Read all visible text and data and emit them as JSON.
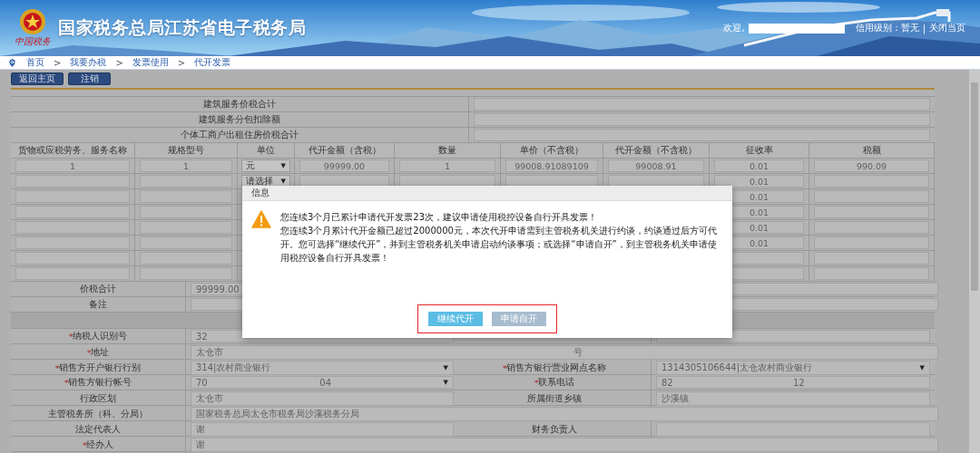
{
  "header": {
    "title": "国家税务总局江苏省电子税务局",
    "logo_caption": "中国税务",
    "welcome": "欢迎,",
    "credit": "信用级别：暂无",
    "separator": "|",
    "close": "关闭当页"
  },
  "breadcrumb": {
    "separator": ">",
    "items": [
      "首页",
      "我要办税",
      "发票使用",
      "代开发票"
    ]
  },
  "toolbar": [
    "返回主页",
    "注销"
  ],
  "summary_rows": [
    {
      "label": "建筑服务价税合计"
    },
    {
      "label": "建筑服务分包扣除额"
    },
    {
      "label": "个体工商户出租住房价税合计"
    }
  ],
  "goods_table": {
    "columns": [
      {
        "label": "货物或应税劳务、服务名称",
        "kind": "text"
      },
      {
        "label": "规格型号",
        "kind": "text"
      },
      {
        "label": "单位",
        "kind": "select"
      },
      {
        "label": "代开金额（含税）",
        "kind": "text"
      },
      {
        "label": "数量",
        "kind": "text"
      },
      {
        "label": "单价（不含税）",
        "kind": "text"
      },
      {
        "label": "代开金额（不含税）",
        "kind": "text"
      },
      {
        "label": "征收率",
        "kind": "text"
      },
      {
        "label": "税额",
        "kind": "text"
      }
    ],
    "rows": [
      [
        "1",
        "1",
        "元",
        "99999.00",
        "1",
        "99008.91089109",
        "99008.91",
        "0.01",
        "990.09"
      ],
      [
        null,
        null,
        "请选择",
        null,
        null,
        null,
        null,
        "0.01",
        null
      ],
      [
        null,
        null,
        null,
        null,
        null,
        null,
        null,
        "0.01",
        null
      ],
      [
        null,
        null,
        null,
        null,
        null,
        null,
        null,
        "0.01",
        null
      ],
      [
        null,
        null,
        null,
        null,
        null,
        null,
        null,
        "0.01",
        null
      ],
      [
        null,
        null,
        null,
        null,
        null,
        null,
        null,
        "0.01",
        null
      ],
      [
        null,
        null,
        null,
        null,
        null,
        null,
        null,
        null,
        null
      ],
      [
        null,
        null,
        null,
        null,
        null,
        null,
        null,
        null,
        null
      ]
    ]
  },
  "caret": "▼",
  "total": {
    "label": "价税合计",
    "value": "99999.00"
  },
  "remark": {
    "label": "备注"
  },
  "required_mark": "*",
  "seller_rows": [
    {
      "fields": [
        {
          "label": "纳税人识别号",
          "required": true,
          "kind": "text",
          "value": "32"
        },
        {
          "kind": "text"
        }
      ]
    },
    {
      "fields": [
        {
          "label": "地址",
          "required": true,
          "kind": "text",
          "value": "太仓市",
          "value_tail": "号"
        }
      ]
    },
    {
      "fields": [
        {
          "label": "销售方开户银行行别",
          "required": true,
          "kind": "select",
          "value": "314|农村商业银行"
        },
        {
          "label": "销售方银行营业网点名称",
          "required": true,
          "kind": "select",
          "value": "1314305106644|太仓农村商业银行"
        }
      ]
    },
    {
      "fields": [
        {
          "label": "销售方银行帐号",
          "required": true,
          "kind": "select",
          "value": "70",
          "value_tail": "04"
        },
        {
          "label": "联系电话",
          "required": true,
          "kind": "text",
          "value": "82",
          "value_tail": "12"
        }
      ]
    },
    {
      "fields": [
        {
          "label": "行政区划",
          "required": false,
          "kind": "text",
          "value": "太仓市"
        },
        {
          "label": "所属街道乡镇",
          "required": false,
          "kind": "text",
          "value": "沙溪镇"
        }
      ]
    },
    {
      "fields": [
        {
          "label": "主管税务所（科、分局）",
          "required": false,
          "kind": "text",
          "value": "国家税务总局太仓市税务局沙溪税务分局"
        }
      ]
    },
    {
      "fields": [
        {
          "label": "法定代表人",
          "required": false,
          "kind": "text",
          "value": "谢"
        },
        {
          "label": "财务负责人",
          "required": false,
          "kind": "text"
        }
      ]
    },
    {
      "fields": [
        {
          "label": "经办人",
          "required": true,
          "kind": "text",
          "value": "谢"
        }
      ]
    }
  ],
  "dialog": {
    "title": "信息",
    "messages": [
      "您连续3个月已累计申请代开发票23次，建议申请使用税控设备自行开具发票！",
      "您连续3个月累计代开金额已超过2000000元，本次代开申请需到主管税务机关进行约谈，约谈通过后方可代开。您可选择“继续代开”，并到主管税务机关申请启动约谈事项；或选择“申请自开”，到主管税务机关申请使用税控设备自行开具发票！"
    ],
    "buttons_highlighted": true,
    "buttons": [
      {
        "label": "继续代开",
        "kind": "primary"
      },
      {
        "label": "申请自开",
        "kind": "secondary"
      }
    ]
  }
}
